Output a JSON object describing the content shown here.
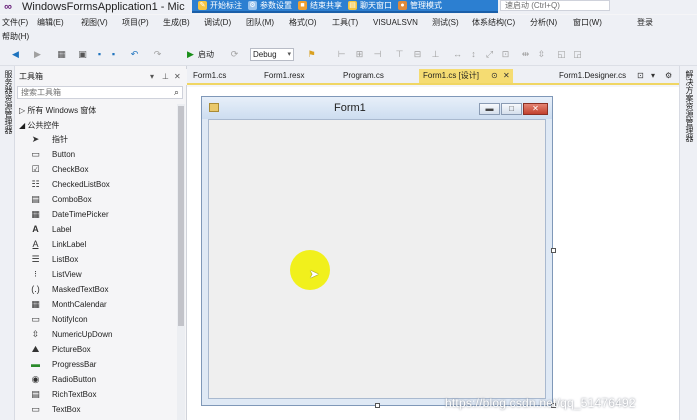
{
  "window": {
    "title": "WindowsFormsApplication1 - Mic",
    "quick_launch": "速启动 (Ctrl+Q)"
  },
  "overlay_toolbar": {
    "items": [
      {
        "label": "开始标注",
        "icon": "pencil-icon",
        "color": "#f5c542"
      },
      {
        "label": "参数设置",
        "icon": "gear-icon",
        "color": "#9bc3ec"
      },
      {
        "label": "结束共享",
        "icon": "stop-icon",
        "color": "#f0a030"
      },
      {
        "label": "聊天窗口",
        "icon": "chat-icon",
        "color": "#f5c542"
      },
      {
        "label": "管理模式",
        "icon": "admin-icon",
        "color": "#e08a3a"
      }
    ]
  },
  "menu": {
    "items": [
      "文件(F)",
      "编辑(E)",
      "视图(V)",
      "项目(P)",
      "生成(B)",
      "调试(D)",
      "团队(M)",
      "格式(O)",
      "工具(T)",
      "VISUALSVN",
      "测试(S)",
      "体系结构(C)",
      "分析(N)",
      "窗口(W)"
    ],
    "help": "帮助(H)",
    "login": "登录"
  },
  "toolbar": {
    "start_label": "启动",
    "configuration": "Debug"
  },
  "server_explorer": {
    "label": "服务器资源管理器"
  },
  "solution_explorer": {
    "label": "解决方案资源管理器"
  },
  "toolbox": {
    "title": "工具箱",
    "search_placeholder": "搜索工具箱",
    "category_all": "所有 Windows 窗体",
    "category_common": "公共控件",
    "items": [
      {
        "label": "指针",
        "icon": "pointer-icon"
      },
      {
        "label": "Button",
        "icon": "button-icon"
      },
      {
        "label": "CheckBox",
        "icon": "checkbox-icon"
      },
      {
        "label": "CheckedListBox",
        "icon": "checkedlistbox-icon"
      },
      {
        "label": "ComboBox",
        "icon": "combobox-icon"
      },
      {
        "label": "DateTimePicker",
        "icon": "datetimepicker-icon"
      },
      {
        "label": "Label",
        "icon": "label-icon"
      },
      {
        "label": "LinkLabel",
        "icon": "linklabel-icon"
      },
      {
        "label": "ListBox",
        "icon": "listbox-icon"
      },
      {
        "label": "ListView",
        "icon": "listview-icon"
      },
      {
        "label": "MaskedTextBox",
        "icon": "maskedtextbox-icon"
      },
      {
        "label": "MonthCalendar",
        "icon": "monthcalendar-icon"
      },
      {
        "label": "NotifyIcon",
        "icon": "notifyicon-icon"
      },
      {
        "label": "NumericUpDown",
        "icon": "numericupdown-icon"
      },
      {
        "label": "PictureBox",
        "icon": "picturebox-icon"
      },
      {
        "label": "ProgressBar",
        "icon": "progressbar-icon"
      },
      {
        "label": "RadioButton",
        "icon": "radiobutton-icon"
      },
      {
        "label": "RichTextBox",
        "icon": "richtextbox-icon"
      },
      {
        "label": "TextBox",
        "icon": "textbox-icon"
      }
    ]
  },
  "tabs": [
    {
      "label": "Form1.cs",
      "active": false
    },
    {
      "label": "Form1.resx",
      "active": false
    },
    {
      "label": "Program.cs",
      "active": false
    },
    {
      "label": "Form1.cs [设计]",
      "active": true
    },
    {
      "label": "Form1.Designer.cs",
      "active": false
    }
  ],
  "designer": {
    "form_caption": "Form1"
  },
  "watermark": "https://blog.csdn.net/qq_51476492",
  "colors": {
    "active_tab": "#f5dc72",
    "overlay_toolbar": "#2c7fd1",
    "cursor_highlight": "#f0ef10"
  }
}
